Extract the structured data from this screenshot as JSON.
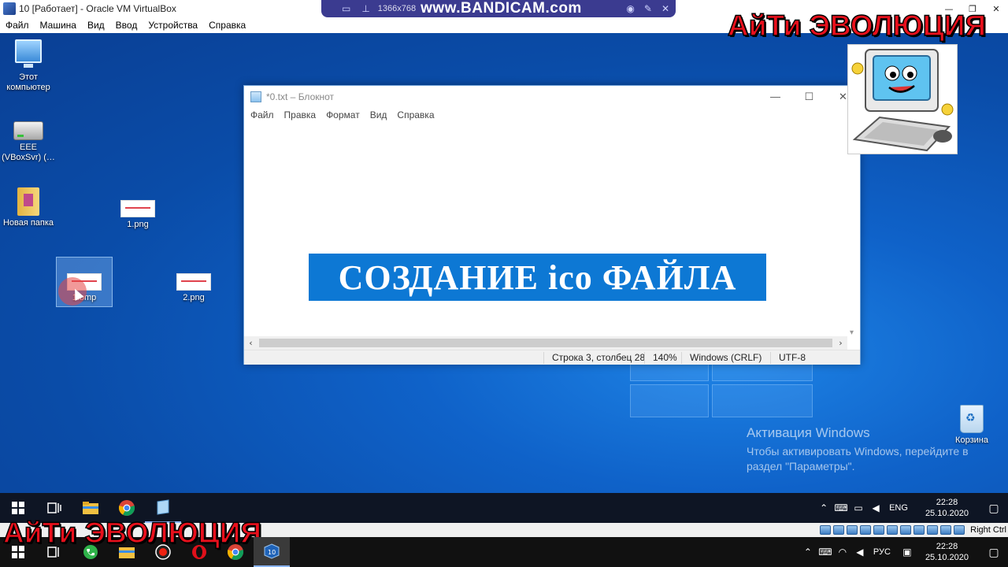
{
  "vbox": {
    "title": "10 [Работает] - Oracle VM VirtualBox",
    "menu": [
      "Файл",
      "Машина",
      "Вид",
      "Ввод",
      "Устройства",
      "Справка"
    ],
    "winbtns": [
      "—",
      "❐",
      "✕"
    ]
  },
  "bandicam": {
    "resolution": "1366x768",
    "url": "www.BANDICAM.com"
  },
  "desktop": {
    "icons": [
      {
        "label": "Этот компьютер",
        "icon": "computer-icon"
      },
      {
        "label": "EEE (VBoxSvr) (…",
        "icon": "network-drive-icon"
      },
      {
        "label": "Новая папка",
        "icon": "folder-icon"
      },
      {
        "label": "1.png",
        "icon": "image-file-icon"
      },
      {
        "label": "1.bmp",
        "icon": "image-file-icon"
      },
      {
        "label": "2.png",
        "icon": "image-file-icon"
      },
      {
        "label": "Корзина",
        "icon": "recycle-bin-icon"
      }
    ],
    "activation_title": "Активация Windows",
    "activation_text": "Чтобы активировать Windows, перейдите в раздел \"Параметры\"."
  },
  "notepad": {
    "title": "*0.txt – Блокнот",
    "menu": [
      "Файл",
      "Правка",
      "Формат",
      "Вид",
      "Справка"
    ],
    "winbtns": [
      "—",
      "☐",
      "✕"
    ],
    "content_heading": "СОЗДАНИЕ ico ФАЙЛА",
    "status": {
      "position": "Строка 3, столбец 28",
      "zoom": "140%",
      "line_endings": "Windows (CRLF)",
      "encoding": "UTF-8"
    }
  },
  "brand": {
    "top": "АйТи ЭВОЛЮЦИЯ",
    "bottom": "АйТи ЭВОЛЮЦИЯ"
  },
  "guest_taskbar": {
    "apps": [
      "start-icon",
      "task-view-icon",
      "file-explorer-icon",
      "chrome-icon",
      "notepad-icon"
    ],
    "lang": "ENG",
    "time": "22:28",
    "date": "25.10.2020"
  },
  "vbox_status": {
    "hostkey": "Right Ctrl"
  },
  "host_taskbar": {
    "apps": [
      "start-icon",
      "task-view-icon",
      "phone-icon",
      "file-explorer-icon",
      "bandicam-icon",
      "opera-icon",
      "chrome-icon",
      "virtualbox-icon"
    ],
    "lang": "РУС",
    "time": "22:28",
    "date": "25.10.2020"
  },
  "colors": {
    "desktop_bg": "#0a4da6",
    "heading_band": "#0d78d4",
    "brand_red": "#e8101c",
    "taskbar": "#0e1524"
  }
}
